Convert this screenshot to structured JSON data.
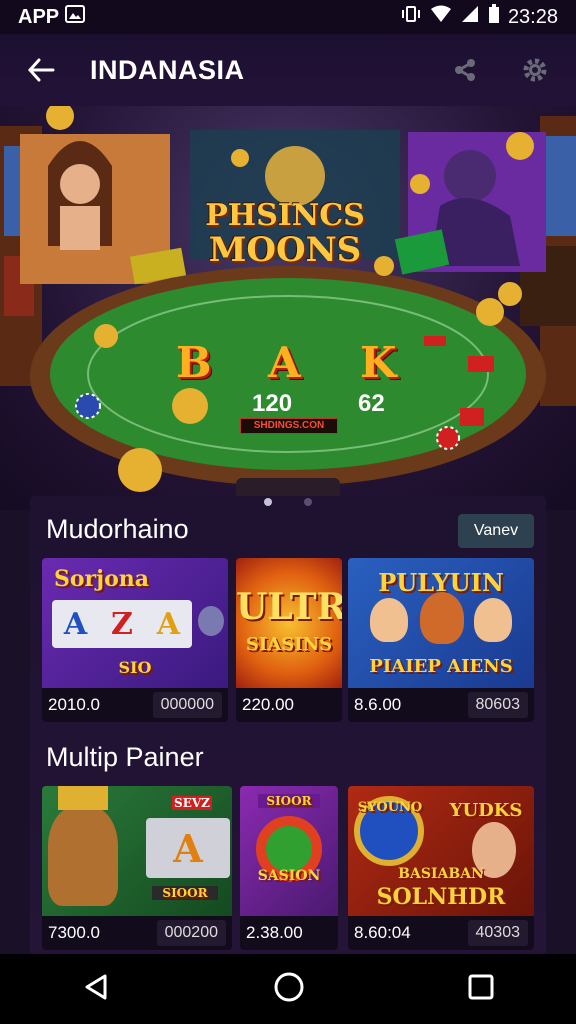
{
  "status_bar": {
    "left_text": "APP",
    "time": "23:28"
  },
  "app_bar": {
    "title": "INDANASIA"
  },
  "hero": {
    "line1": "PHSINCS",
    "line2": "MOONS",
    "letters": [
      "B",
      "A",
      "K"
    ],
    "number_left": "120",
    "number_right": "62",
    "sign": "SHDINGS.CON"
  },
  "sections": [
    {
      "title": "Mudorhaino",
      "action": "Vanev",
      "cards": [
        {
          "title": "Sorjona",
          "subtitle": "SIO",
          "value": "2010.0",
          "secondary": "000000",
          "reel": [
            "A",
            "Z",
            "A"
          ]
        },
        {
          "title": "ULTRA",
          "subtitle": "SIASINS",
          "value": "220.00",
          "secondary": ""
        },
        {
          "title": "PULYUIN",
          "subtitle": "PIAIEP AIENS",
          "value": "8.6.00",
          "secondary": "80603"
        }
      ]
    },
    {
      "title": "Multip Painer",
      "action": "",
      "cards": [
        {
          "title": "SEVZ",
          "subtitle": "SIOOR",
          "value": "7300.0",
          "secondary": "000200",
          "reel": [
            "A"
          ]
        },
        {
          "title": "SIOOR",
          "subtitle": "SASION",
          "value": "2.38.00",
          "secondary": ""
        },
        {
          "title": "SYOUNO",
          "subtitle": "YUDKS",
          "tagline": "BASIABAN",
          "tagline2": "SOLNHDR",
          "value": "8.60:04",
          "secondary": "40303"
        }
      ]
    }
  ],
  "colors": {
    "accent_gold": "#ffc640",
    "felt_green": "#2e8a2e",
    "background": "#1a1028"
  }
}
